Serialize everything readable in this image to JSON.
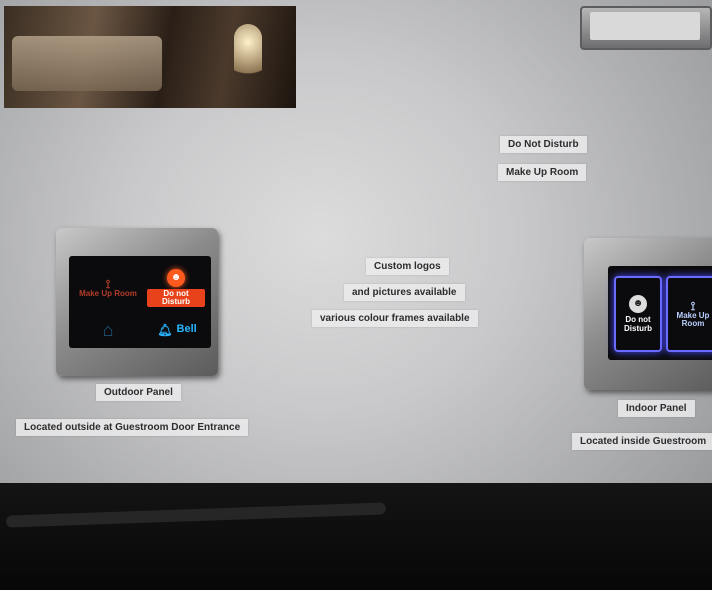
{
  "labels": {
    "do_not_disturb": "Do Not Disturb",
    "make_up_room": "Make Up Room",
    "custom_logos": "Custom logos",
    "pictures_available": "and pictures available",
    "colour_frames": "various colour frames available",
    "outdoor_panel": "Outdoor Panel",
    "outdoor_location": "Located outside at Guestroom Door Entrance",
    "indoor_panel": "Indoor Panel",
    "indoor_location": "Located inside Guestroom"
  },
  "outdoor_panel_buttons": {
    "make_up_room": "Make Up Room",
    "do_not_disturb": "Do not Disturb",
    "bell": "Bell",
    "icons": {
      "make_up_room": "broom-icon",
      "do_not_disturb": "dnd-icon",
      "home": "house-icon",
      "bell": "bell-icon"
    },
    "colors": {
      "make_up_room": "#b33c2a",
      "do_not_disturb": "#ff5a1e",
      "bell": "#27b5ff",
      "home": "#1f5f86"
    }
  },
  "indoor_panel_buttons": {
    "do_not_disturb": "Do not Disturb",
    "make_up_room": "Make Up Room",
    "icons": {
      "do_not_disturb": "dnd-icon",
      "make_up_room": "broom-icon"
    },
    "colors": {
      "frame_glow": "#6b6bff"
    }
  }
}
